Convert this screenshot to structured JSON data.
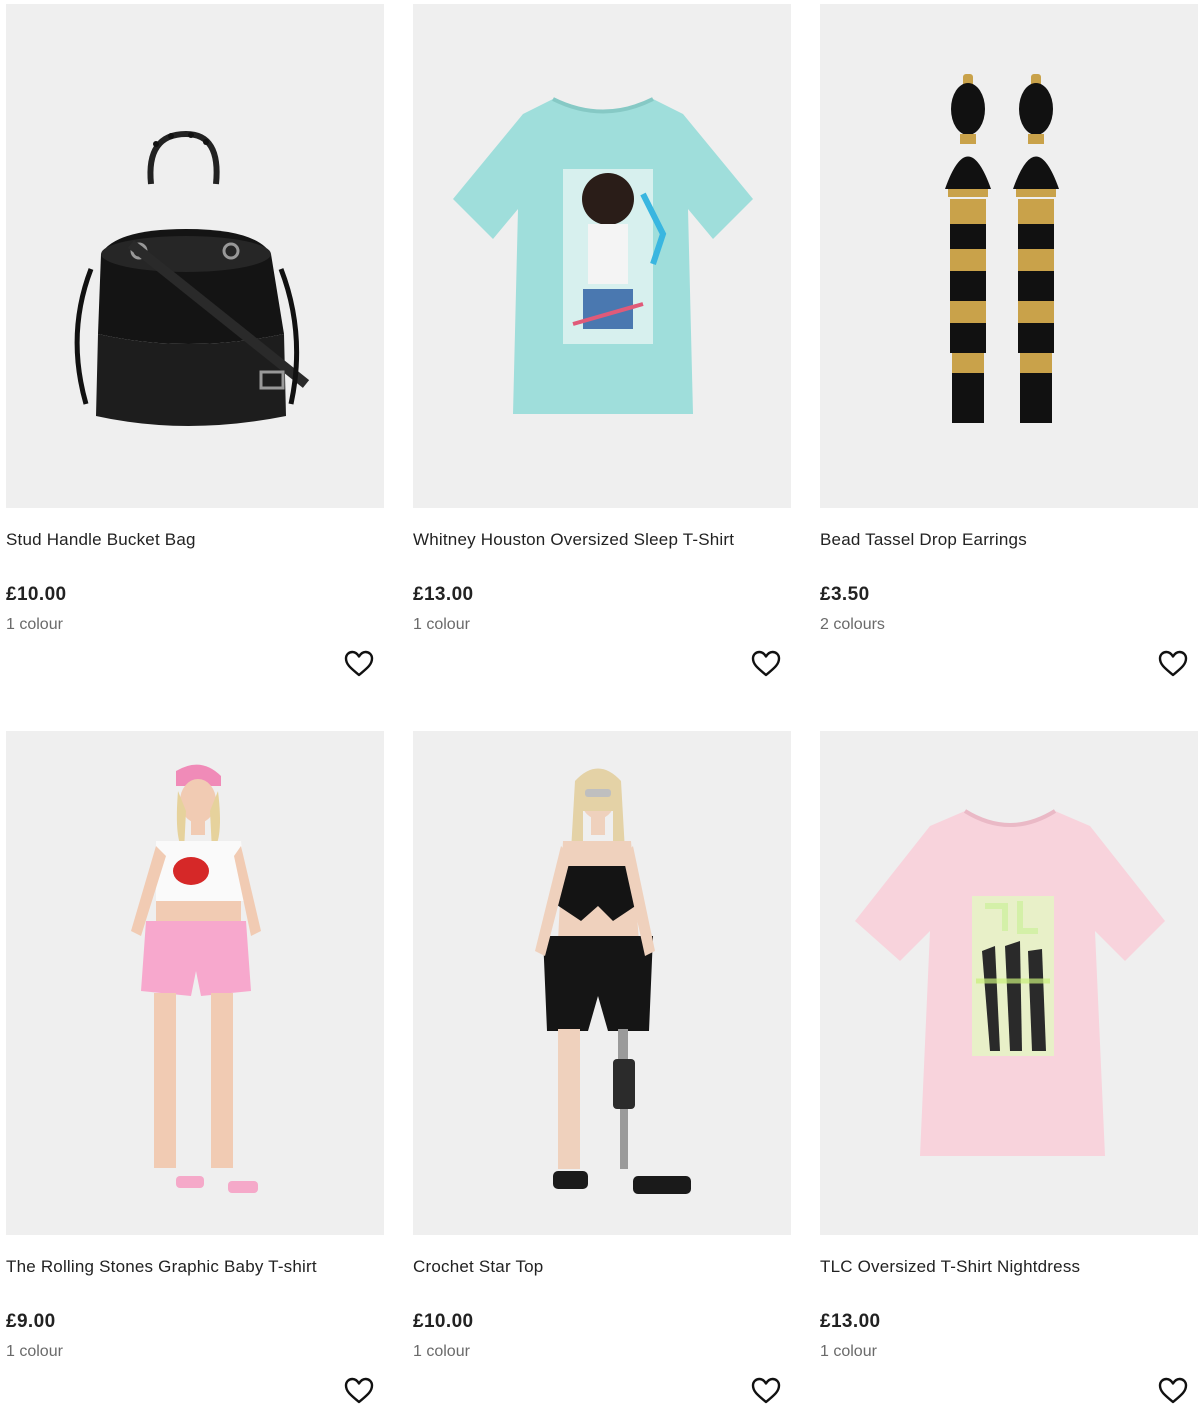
{
  "products": [
    {
      "name": "Stud Handle Bucket Bag",
      "price": "£10.00",
      "colours": "1 colour",
      "image": "black-bucket-bag"
    },
    {
      "name": "Whitney Houston Oversized Sleep T-Shirt",
      "price": "£13.00",
      "colours": "1 colour",
      "image": "mint-graphic-tshirt"
    },
    {
      "name": "Bead Tassel Drop Earrings",
      "price": "£3.50",
      "colours": "2 colours",
      "image": "black-gold-tassel-earrings"
    },
    {
      "name": "The Rolling Stones Graphic Baby T-shirt",
      "price": "£9.00",
      "colours": "1 colour",
      "image": "model-white-crop-tee-pink-shorts"
    },
    {
      "name": "Crochet Star Top",
      "price": "£10.00",
      "colours": "1 colour",
      "image": "model-black-crochet-top"
    },
    {
      "name": "TLC Oversized T-Shirt Nightdress",
      "price": "£13.00",
      "colours": "1 colour",
      "image": "pink-graphic-tshirt-nightdress"
    }
  ],
  "icons": {
    "favourite": "heart-outline-icon"
  },
  "colors": {
    "image_bg": "#efefef",
    "text": "#222222",
    "muted": "#6a6a6a"
  }
}
